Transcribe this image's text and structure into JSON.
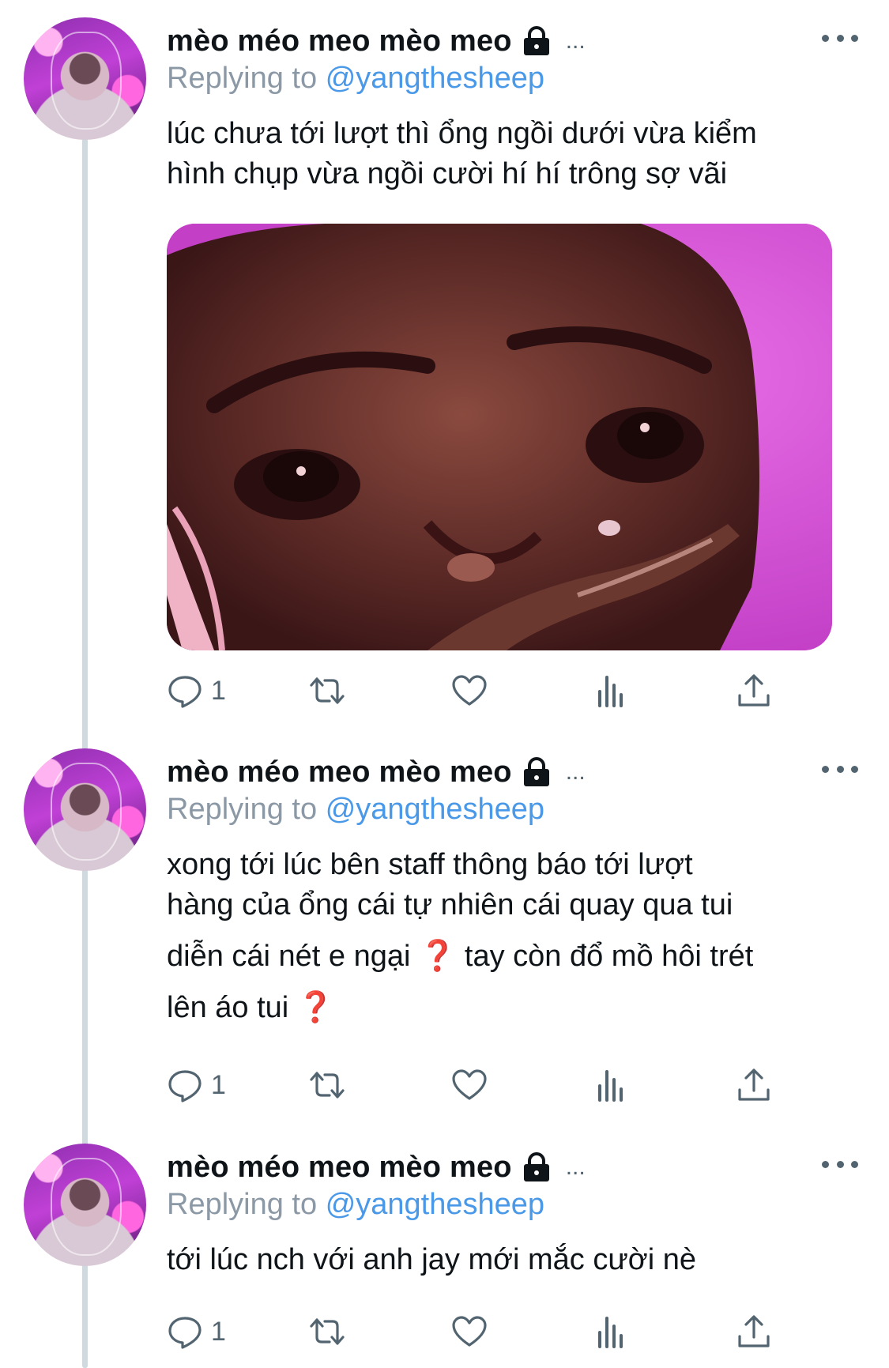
{
  "tweets": [
    {
      "author": "mèo méo meo mèo meo",
      "truncation": "...",
      "reply_prefix": "Replying to",
      "reply_to": "@yangthesheep",
      "text_lines": [
        "lúc chưa tới lượt thì ổng ngồi dưới vừa kiểm",
        "hình chụp vừa ngồi cười hí hí trông sợ vãi"
      ],
      "has_media": true,
      "actions": {
        "reply_count": "1",
        "retweet_count": "",
        "like_count": ""
      }
    },
    {
      "author": "mèo méo meo mèo meo",
      "truncation": "...",
      "reply_prefix": "Replying to",
      "reply_to": "@yangthesheep",
      "text_lines": [
        "xong tới lúc bên staff thông báo tới lượt",
        "hàng của ổng cái tự nhiên cái quay qua tui",
        "diễn cái nét e ngại",
        "tay còn đổ mồ hôi trét",
        "lên áo tui"
      ],
      "emoji": "❓",
      "has_media": false,
      "actions": {
        "reply_count": "1",
        "retweet_count": "",
        "like_count": ""
      }
    },
    {
      "author": "mèo méo meo mèo meo",
      "truncation": "...",
      "reply_prefix": "Replying to",
      "reply_to": "@yangthesheep",
      "text_lines": [
        "tới lúc nch với anh jay mới mắc cười nè"
      ],
      "has_media": false,
      "actions": {
        "reply_count": "1",
        "retweet_count": "",
        "like_count": ""
      }
    }
  ],
  "icons": {
    "lock": "lock-icon",
    "more": "more-horizontal-icon",
    "reply": "reply-icon",
    "retweet": "retweet-icon",
    "like": "heart-icon",
    "analytics": "analytics-icon",
    "share": "share-icon"
  },
  "colors": {
    "text": "#0f1419",
    "secondary": "#536471",
    "reply_label": "#8b98a5",
    "mention": "#4a99e9",
    "thread_line": "#cfd9de",
    "emoji_red": "#cc2a2a"
  }
}
